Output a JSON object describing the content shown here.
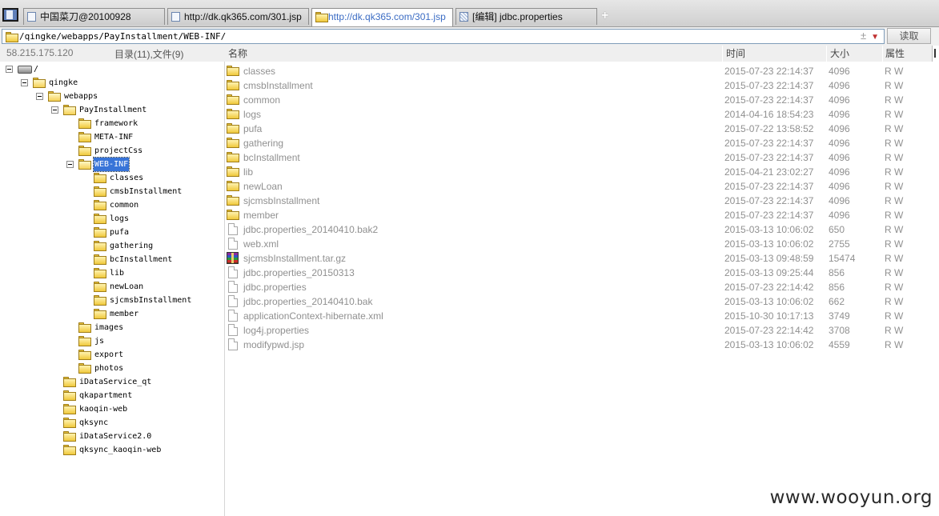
{
  "tabs": [
    {
      "label": "中国菜刀@20100928",
      "active": false,
      "icon": "page-icon"
    },
    {
      "label": "http://dk.qk365.com/301.jsp",
      "active": false,
      "icon": "page-icon"
    },
    {
      "label": "http://dk.qk365.com/301.jsp",
      "active": true,
      "icon": "folder-icon"
    },
    {
      "label": "[编辑] jdbc.properties",
      "active": false,
      "icon": "text-file-icon"
    }
  ],
  "new_tab_label": "+",
  "address": {
    "path": "/qingke/webapps/PayInstallment/WEB-INF/",
    "controls": "±",
    "dropdown": "▼"
  },
  "read_button": "读取",
  "left": {
    "ip": "58.215.175.120",
    "count": "目录(11),文件(9)"
  },
  "tree": [
    {
      "label": "/",
      "type": "drive",
      "expanded": true
    },
    {
      "label": "qingke",
      "type": "folder",
      "expanded": true
    },
    {
      "label": "webapps",
      "type": "folder",
      "expanded": true
    },
    {
      "label": "PayInstallment",
      "type": "folder",
      "expanded": true
    },
    {
      "label": "framework",
      "type": "folder"
    },
    {
      "label": "META-INF",
      "type": "folder"
    },
    {
      "label": "projectCss",
      "type": "folder"
    },
    {
      "label": "WEB-INF",
      "type": "folder",
      "expanded": true,
      "selected": true
    },
    {
      "label": "classes",
      "type": "folder"
    },
    {
      "label": "cmsbInstallment",
      "type": "folder"
    },
    {
      "label": "common",
      "type": "folder"
    },
    {
      "label": "logs",
      "type": "folder"
    },
    {
      "label": "pufa",
      "type": "folder"
    },
    {
      "label": "gathering",
      "type": "folder"
    },
    {
      "label": "bcInstallment",
      "type": "folder"
    },
    {
      "label": "lib",
      "type": "folder"
    },
    {
      "label": "newLoan",
      "type": "folder"
    },
    {
      "label": "sjcmsbInstallment",
      "type": "folder"
    },
    {
      "label": "member",
      "type": "folder"
    },
    {
      "label": "images",
      "type": "folder"
    },
    {
      "label": "js",
      "type": "folder"
    },
    {
      "label": "export",
      "type": "folder"
    },
    {
      "label": "photos",
      "type": "folder"
    },
    {
      "label": "iDataService_qt",
      "type": "folder"
    },
    {
      "label": "qkapartment",
      "type": "folder"
    },
    {
      "label": "kaoqin-web",
      "type": "folder"
    },
    {
      "label": "qksync",
      "type": "folder"
    },
    {
      "label": "iDataService2.0",
      "type": "folder"
    },
    {
      "label": "qksync_kaoqin-web",
      "type": "folder"
    }
  ],
  "columns": {
    "name": "名称",
    "time": "时间",
    "size": "大小",
    "attr": "属性"
  },
  "files": [
    {
      "name": "classes",
      "type": "folder",
      "time": "2015-07-23 22:14:37",
      "size": "4096",
      "attr": "R W"
    },
    {
      "name": "cmsbInstallment",
      "type": "folder",
      "time": "2015-07-23 22:14:37",
      "size": "4096",
      "attr": "R W"
    },
    {
      "name": "common",
      "type": "folder",
      "time": "2015-07-23 22:14:37",
      "size": "4096",
      "attr": "R W"
    },
    {
      "name": "logs",
      "type": "folder",
      "time": "2014-04-16 18:54:23",
      "size": "4096",
      "attr": "R W"
    },
    {
      "name": "pufa",
      "type": "folder",
      "time": "2015-07-22 13:58:52",
      "size": "4096",
      "attr": "R W"
    },
    {
      "name": "gathering",
      "type": "folder",
      "time": "2015-07-23 22:14:37",
      "size": "4096",
      "attr": "R W"
    },
    {
      "name": "bcInstallment",
      "type": "folder",
      "time": "2015-07-23 22:14:37",
      "size": "4096",
      "attr": "R W"
    },
    {
      "name": "lib",
      "type": "folder",
      "time": "2015-04-21 23:02:27",
      "size": "4096",
      "attr": "R W"
    },
    {
      "name": "newLoan",
      "type": "folder",
      "time": "2015-07-23 22:14:37",
      "size": "4096",
      "attr": "R W"
    },
    {
      "name": "sjcmsbInstallment",
      "type": "folder",
      "time": "2015-07-23 22:14:37",
      "size": "4096",
      "attr": "R W"
    },
    {
      "name": "member",
      "type": "folder",
      "time": "2015-07-23 22:14:37",
      "size": "4096",
      "attr": "R W"
    },
    {
      "name": "jdbc.properties_20140410.bak2",
      "type": "file",
      "time": "2015-03-13 10:06:02",
      "size": "650",
      "attr": "R W"
    },
    {
      "name": "web.xml",
      "type": "file",
      "time": "2015-03-13 10:06:02",
      "size": "2755",
      "attr": "R W"
    },
    {
      "name": "sjcmsbInstallment.tar.gz",
      "type": "archive",
      "time": "2015-03-13 09:48:59",
      "size": "15474",
      "attr": "R W"
    },
    {
      "name": "jdbc.properties_20150313",
      "type": "file",
      "time": "2015-03-13 09:25:44",
      "size": "856",
      "attr": "R W"
    },
    {
      "name": "jdbc.properties",
      "type": "file",
      "time": "2015-07-23 22:14:42",
      "size": "856",
      "attr": "R W"
    },
    {
      "name": "jdbc.properties_20140410.bak",
      "type": "file",
      "time": "2015-03-13 10:06:02",
      "size": "662",
      "attr": "R W"
    },
    {
      "name": "applicationContext-hibernate.xml",
      "type": "file",
      "time": "2015-10-30 10:17:13",
      "size": "3749",
      "attr": "R W"
    },
    {
      "name": "log4j.properties",
      "type": "file",
      "time": "2015-07-23 22:14:42",
      "size": "3708",
      "attr": "R W"
    },
    {
      "name": "modifypwd.jsp",
      "type": "file",
      "time": "2015-03-13 10:06:02",
      "size": "4559",
      "attr": "R W"
    }
  ],
  "watermark": "www.wooyun.org",
  "colors": {
    "selection": "#3874d8",
    "active_tab_text": "#3b6cc4",
    "muted_text": "#909090"
  }
}
